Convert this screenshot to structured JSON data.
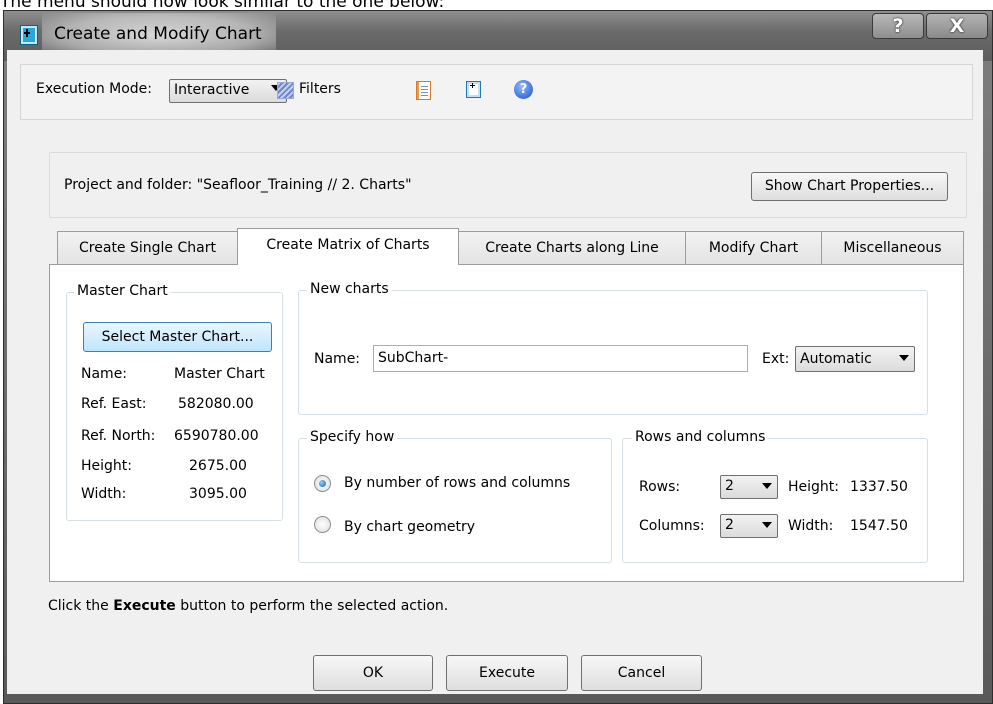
{
  "caption": "The menu should now look similar to the one below:",
  "window": {
    "title": "Create and Modify Chart",
    "help_glyph": "?",
    "close_glyph": "X"
  },
  "toolbar": {
    "execution_mode_label": "Execution Mode:",
    "execution_mode_value": "Interactive",
    "filters_label": "Filters",
    "help_glyph": "?"
  },
  "project": {
    "folder_text": "Project and folder: \"Seafloor_Training // 2. Charts\"",
    "show_properties_label": "Show Chart Properties..."
  },
  "tabs": [
    {
      "label": "Create Single Chart",
      "active": false
    },
    {
      "label": "Create Matrix of Charts",
      "active": true
    },
    {
      "label": "Create Charts along Line",
      "active": false
    },
    {
      "label": "Modify Chart",
      "active": false
    },
    {
      "label": "Miscellaneous",
      "active": false
    }
  ],
  "master_chart": {
    "group_label": "Master Chart",
    "select_button": "Select Master Chart...",
    "rows": [
      {
        "label": "Name:",
        "value": "Master Chart"
      },
      {
        "label": "Ref. East:",
        "value": "582080.00"
      },
      {
        "label": "Ref. North:",
        "value": "6590780.00"
      },
      {
        "label": "Height:",
        "value": "2675.00"
      },
      {
        "label": "Width:",
        "value": "3095.00"
      }
    ]
  },
  "new_charts": {
    "group_label": "New charts",
    "name_label": "Name:",
    "name_value": "SubChart-",
    "ext_label": "Ext:",
    "ext_value": "Automatic"
  },
  "specify_how": {
    "group_label": "Specify how",
    "options": [
      {
        "label": "By number of rows and columns",
        "checked": true
      },
      {
        "label": "By chart geometry",
        "checked": false
      }
    ]
  },
  "rows_columns": {
    "group_label": "Rows and columns",
    "rows_label": "Rows:",
    "rows_value": "2",
    "height_label": "Height:",
    "height_value": "1337.50",
    "columns_label": "Columns:",
    "columns_value": "2",
    "width_label": "Width:",
    "width_value": "1547.50"
  },
  "hint": {
    "prefix": "Click the ",
    "bold": "Execute",
    "suffix": " button to perform the selected action."
  },
  "buttons": {
    "ok": "OK",
    "execute": "Execute",
    "cancel": "Cancel"
  }
}
